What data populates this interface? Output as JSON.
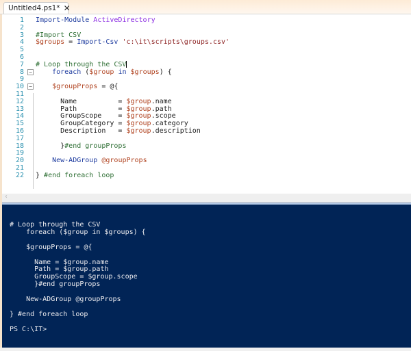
{
  "tab": {
    "title": "Untitled4.ps1*",
    "close_icon": "close-icon"
  },
  "editor": {
    "lines": [
      {
        "n": "1",
        "fold": false,
        "tokens": [
          {
            "t": "kw",
            "v": "Import-Module "
          },
          {
            "t": "attr",
            "v": "ActiveDirectory"
          }
        ]
      },
      {
        "n": "2",
        "fold": false,
        "tokens": []
      },
      {
        "n": "3",
        "fold": false,
        "tokens": [
          {
            "t": "cm",
            "v": "#Import CSV"
          }
        ]
      },
      {
        "n": "4",
        "fold": false,
        "tokens": [
          {
            "t": "var",
            "v": "$groups"
          },
          {
            "t": "plain",
            "v": " = "
          },
          {
            "t": "kw",
            "v": "Import-Csv "
          },
          {
            "t": "str",
            "v": "'c:\\it\\scripts\\groups.csv'"
          }
        ]
      },
      {
        "n": "5",
        "fold": false,
        "tokens": []
      },
      {
        "n": "6",
        "fold": false,
        "tokens": []
      },
      {
        "n": "7",
        "fold": false,
        "cursor": true,
        "tokens": [
          {
            "t": "cm",
            "v": "# Loop through the CSV"
          }
        ]
      },
      {
        "n": "8",
        "fold": true,
        "tokens": [
          {
            "t": "plain",
            "v": "    "
          },
          {
            "t": "kw",
            "v": "foreach"
          },
          {
            "t": "plain",
            "v": " ("
          },
          {
            "t": "var",
            "v": "$group"
          },
          {
            "t": "plain",
            "v": " "
          },
          {
            "t": "kw",
            "v": "in"
          },
          {
            "t": "plain",
            "v": " "
          },
          {
            "t": "var",
            "v": "$groups"
          },
          {
            "t": "plain",
            "v": ") {"
          }
        ]
      },
      {
        "n": "9",
        "fold": false,
        "tokens": []
      },
      {
        "n": "10",
        "fold": true,
        "tokens": [
          {
            "t": "plain",
            "v": "    "
          },
          {
            "t": "var",
            "v": "$groupProps"
          },
          {
            "t": "plain",
            "v": " = @{"
          }
        ]
      },
      {
        "n": "11",
        "fold": false,
        "tokens": []
      },
      {
        "n": "12",
        "fold": false,
        "tokens": [
          {
            "t": "plain",
            "v": "      Name          = "
          },
          {
            "t": "var",
            "v": "$group"
          },
          {
            "t": "plain",
            "v": ".name"
          }
        ]
      },
      {
        "n": "13",
        "fold": false,
        "tokens": [
          {
            "t": "plain",
            "v": "      Path          = "
          },
          {
            "t": "var",
            "v": "$group"
          },
          {
            "t": "plain",
            "v": ".path"
          }
        ]
      },
      {
        "n": "14",
        "fold": false,
        "tokens": [
          {
            "t": "plain",
            "v": "      GroupScope    = "
          },
          {
            "t": "var",
            "v": "$group"
          },
          {
            "t": "plain",
            "v": ".scope"
          }
        ]
      },
      {
        "n": "15",
        "fold": false,
        "tokens": [
          {
            "t": "plain",
            "v": "      GroupCategory = "
          },
          {
            "t": "var",
            "v": "$group"
          },
          {
            "t": "plain",
            "v": ".category"
          }
        ]
      },
      {
        "n": "16",
        "fold": false,
        "tokens": [
          {
            "t": "plain",
            "v": "      Description   = "
          },
          {
            "t": "var",
            "v": "$group"
          },
          {
            "t": "plain",
            "v": ".description"
          }
        ]
      },
      {
        "n": "17",
        "fold": false,
        "tokens": []
      },
      {
        "n": "18",
        "fold": false,
        "tokens": [
          {
            "t": "plain",
            "v": "      }"
          },
          {
            "t": "cm",
            "v": "#end groupProps"
          }
        ]
      },
      {
        "n": "19",
        "fold": false,
        "tokens": []
      },
      {
        "n": "20",
        "fold": false,
        "tokens": [
          {
            "t": "plain",
            "v": "    "
          },
          {
            "t": "kw",
            "v": "New-ADGroup"
          },
          {
            "t": "plain",
            "v": " "
          },
          {
            "t": "var",
            "v": "@groupProps"
          }
        ]
      },
      {
        "n": "21",
        "fold": false,
        "tokens": []
      },
      {
        "n": "22",
        "fold": false,
        "tokens": [
          {
            "t": "plain",
            "v": "} "
          },
          {
            "t": "cm",
            "v": "#end foreach loop"
          }
        ]
      }
    ]
  },
  "console": {
    "lines": [
      "# Loop through the CSV",
      "    foreach ($group in $groups) {",
      "",
      "    $groupProps = @{",
      "",
      "      Name = $group.name",
      "      Path = $group.path",
      "      GroupScope = $group.scope",
      "      }#end groupProps",
      "",
      "    New-ADGroup @groupProps",
      "",
      "} #end foreach loop",
      "",
      "PS C:\\IT>"
    ]
  },
  "colors": {
    "console_bg": "#012456",
    "keyword": "#1c3a9e",
    "comment": "#2d6e33",
    "variable": "#b0421f",
    "line_number": "#2b91af"
  }
}
